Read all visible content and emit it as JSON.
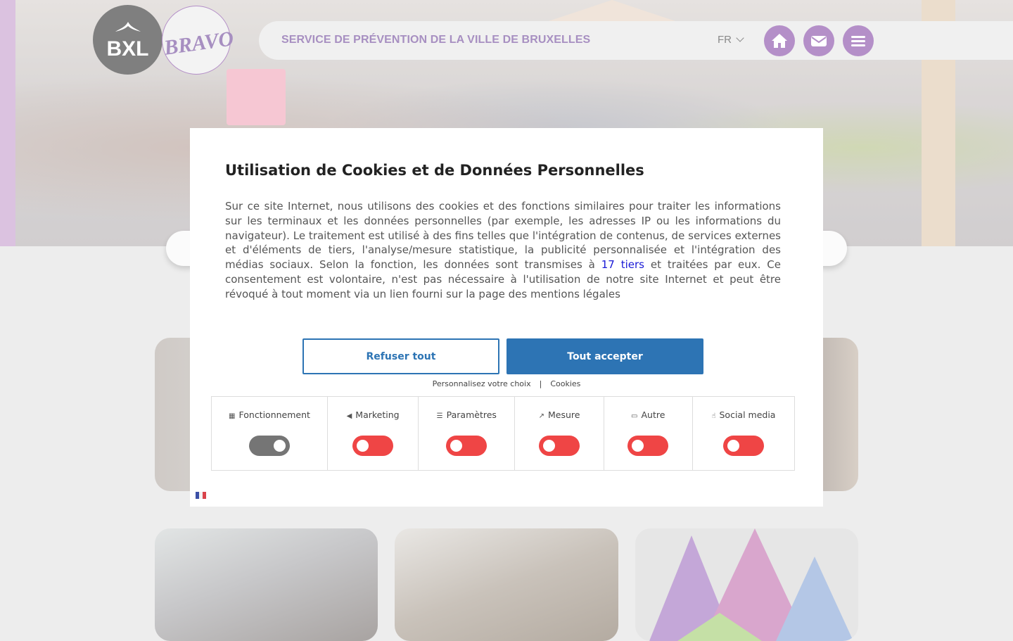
{
  "header": {
    "logo_bxl": "BXL",
    "logo_bravo": "BRAVO",
    "site_title": "SERVICE DE PRÉVENTION DE LA VILLE DE BRUXELLES",
    "language": "FR",
    "buttons": [
      {
        "name": "home-icon"
      },
      {
        "name": "mail-icon"
      },
      {
        "name": "menu-icon"
      }
    ]
  },
  "colors": {
    "brand_purple": "#b48fc8",
    "primary_blue": "#2d74b4",
    "toggle_off": "#ef4545",
    "toggle_on": "#757575"
  },
  "cookie_modal": {
    "title": "Utilisation de Cookies et de Données Personnelles",
    "description_before_link": "Sur ce site Internet, nous utilisons des cookies et des fonctions similaires pour traiter les informations sur les terminaux et les données personnelles (par exemple, les adresses IP ou les informations du navigateur). Le traitement est utilisé à des fins telles que l'intégration de contenus, de services externes et d'éléments de tiers, l'analyse/mesure statistique, la publicité personnalisée et l'intégration des médias sociaux. Selon la fonction, les données sont transmises à ",
    "description_link": "17 tiers",
    "description_after_link": " et traitées par eux. Ce consentement est volontaire, n'est pas nécessaire à l'utilisation de notre site Internet et peut être révoqué à tout moment via un lien fourni sur la page des mentions légales",
    "refuse_label": "Refuser tout",
    "accept_label": "Tout accepter",
    "customize_label": "Personnalisez votre choix",
    "separator": "|",
    "cookies_label": "Cookies",
    "categories": [
      {
        "label": "Fonctionnement",
        "icon": "grid-icon",
        "enabled": true
      },
      {
        "label": "Marketing",
        "icon": "megaphone-icon",
        "enabled": false
      },
      {
        "label": "Paramètres",
        "icon": "sliders-icon",
        "enabled": false
      },
      {
        "label": "Mesure",
        "icon": "chart-icon",
        "enabled": false
      },
      {
        "label": "Autre",
        "icon": "chat-icon",
        "enabled": false
      },
      {
        "label": "Social media",
        "icon": "thumbs-up-icon",
        "enabled": false
      }
    ],
    "language_flag": "fr-flag-icon"
  }
}
